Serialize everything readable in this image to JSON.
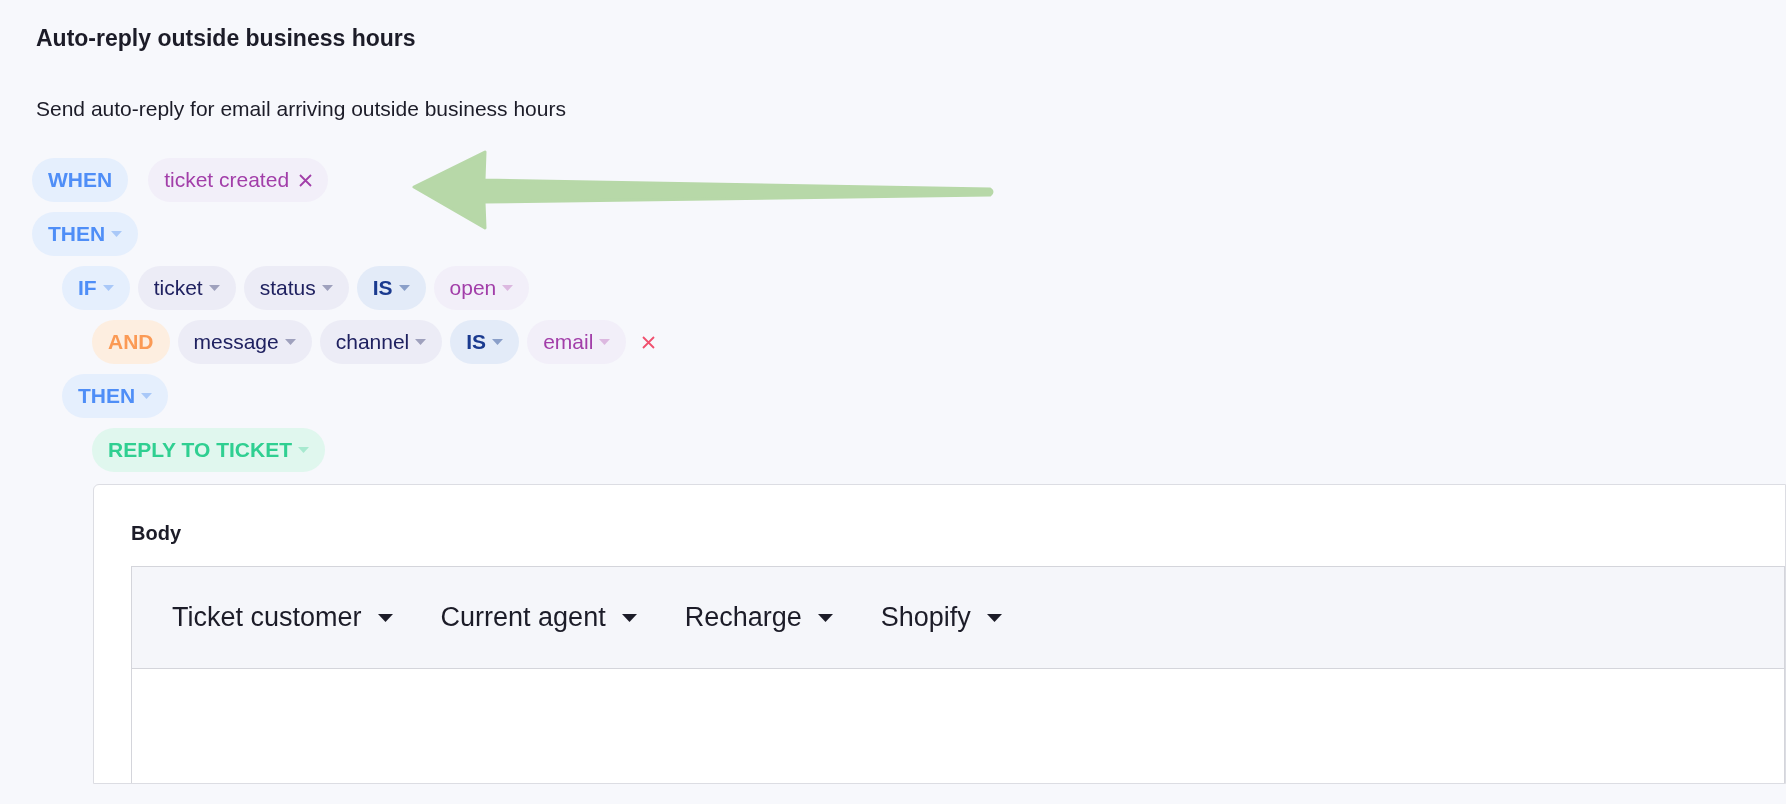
{
  "title": "Auto-reply outside business hours",
  "description": "Send auto-reply for email arriving outside business hours",
  "rule": [
    {
      "tokens": [
        {
          "kind": "keyword",
          "label": "WHEN",
          "dropdown": false
        },
        {
          "kind": "value",
          "label": "ticket created",
          "dropdown": false,
          "removable": true
        }
      ],
      "removable": false
    },
    {
      "tokens": [
        {
          "kind": "keyword",
          "label": "THEN",
          "dropdown": true
        }
      ],
      "removable": false,
      "children": [
        {
          "tokens": [
            {
              "kind": "keyword",
              "label": "IF",
              "dropdown": true
            },
            {
              "kind": "field",
              "label": "ticket",
              "dropdown": true
            },
            {
              "kind": "field",
              "label": "status",
              "dropdown": true
            },
            {
              "kind": "operator",
              "label": "IS",
              "dropdown": true
            },
            {
              "kind": "value",
              "label": "open",
              "dropdown": true
            }
          ],
          "removable": false,
          "children": [
            {
              "tokens": [
                {
                  "kind": "and",
                  "label": "AND",
                  "dropdown": false
                },
                {
                  "kind": "field",
                  "label": "message",
                  "dropdown": true
                },
                {
                  "kind": "field",
                  "label": "channel",
                  "dropdown": true
                },
                {
                  "kind": "operator",
                  "label": "IS",
                  "dropdown": true
                },
                {
                  "kind": "value",
                  "label": "email",
                  "dropdown": true
                }
              ],
              "removable": true
            }
          ]
        },
        {
          "tokens": [
            {
              "kind": "keyword",
              "label": "THEN",
              "dropdown": true
            }
          ],
          "removable": false,
          "children": [
            {
              "tokens": [
                {
                  "kind": "action",
                  "label": "REPLY TO TICKET",
                  "dropdown": true
                }
              ],
              "removable": false
            }
          ]
        }
      ]
    }
  ],
  "action_card": {
    "label": "Body",
    "toolbar": [
      {
        "label": "Ticket customer"
      },
      {
        "label": "Current agent"
      },
      {
        "label": "Recharge"
      },
      {
        "label": "Shopify"
      }
    ]
  }
}
